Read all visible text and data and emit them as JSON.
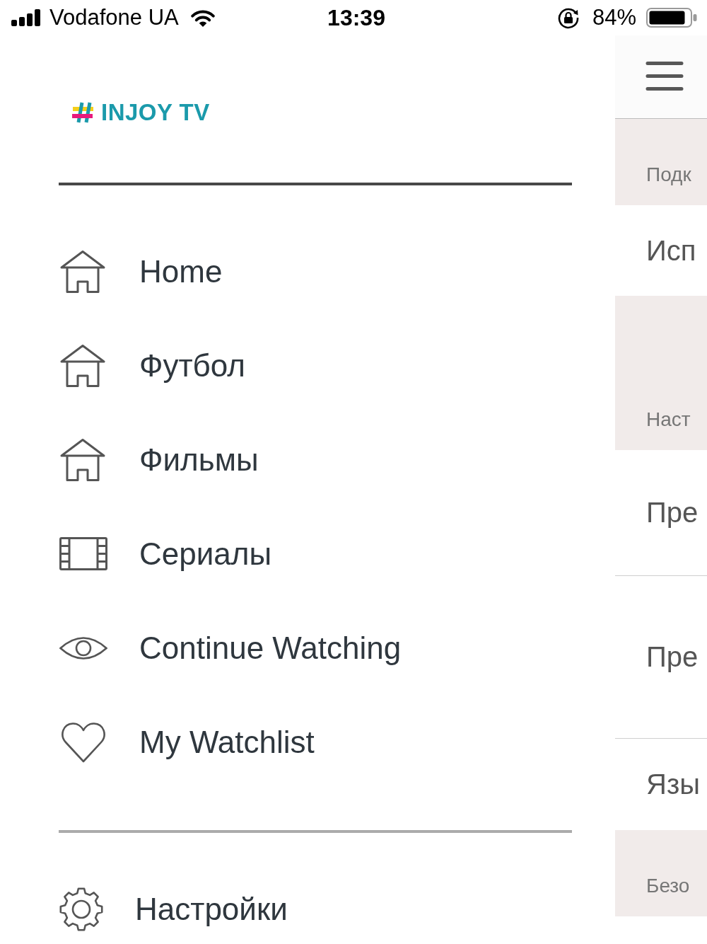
{
  "status_bar": {
    "carrier": "Vodafone UA",
    "time": "13:39",
    "battery": "84%"
  },
  "drawer": {
    "logo": "INJOY TV",
    "menu": [
      {
        "kind": "home",
        "label": "Home"
      },
      {
        "kind": "home",
        "label": "Футбол"
      },
      {
        "kind": "home",
        "label": "Фильмы"
      },
      {
        "kind": "film",
        "label": "Сериалы"
      },
      {
        "kind": "eye",
        "label": "Continue Watching"
      },
      {
        "kind": "heart",
        "label": "My Watchlist"
      }
    ],
    "footer": [
      {
        "kind": "gear",
        "label": "Настройки"
      }
    ]
  },
  "settings_panel": {
    "items": [
      {
        "kind": "section",
        "text": "Подк"
      },
      {
        "kind": "row",
        "text": "Исп"
      },
      {
        "kind": "section",
        "text": "Наст"
      },
      {
        "kind": "row",
        "text": "Пре"
      },
      {
        "kind": "row",
        "text": "Пре"
      },
      {
        "kind": "row",
        "text": "Язы"
      },
      {
        "kind": "section",
        "text": "Безо"
      }
    ]
  }
}
